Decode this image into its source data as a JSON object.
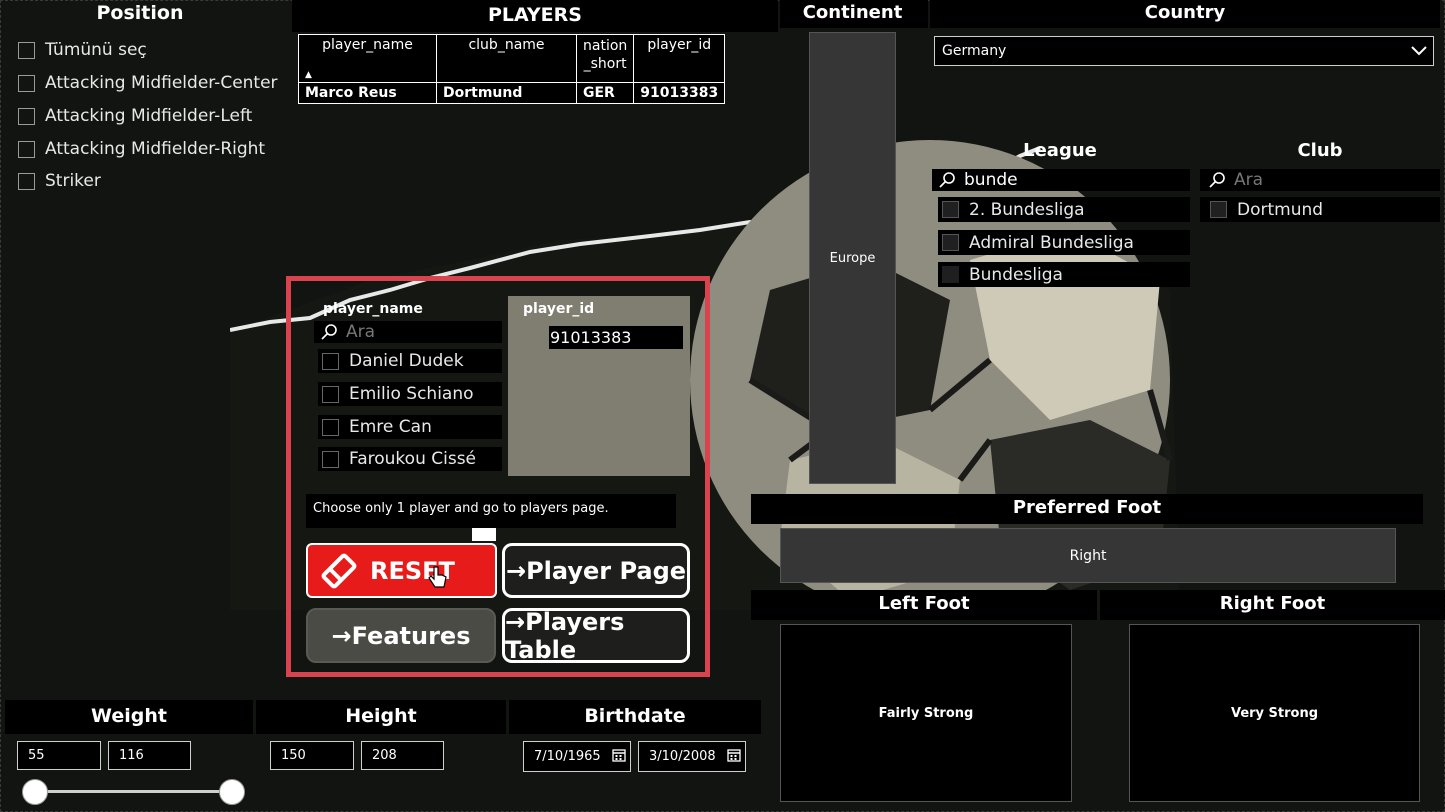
{
  "position": {
    "title": "Position",
    "items": [
      {
        "label": "Tümünü seç"
      },
      {
        "label": "Attacking Midfielder-Center"
      },
      {
        "label": "Attacking Midfielder-Left"
      },
      {
        "label": "Attacking Midfielder-Right"
      },
      {
        "label": "Striker"
      }
    ]
  },
  "players_table": {
    "title": "PLAYERS",
    "columns": [
      "player_name",
      "club_name",
      "nation\n_short",
      "player_id"
    ],
    "rows": [
      [
        "Marco Reus",
        "Dortmund",
        "GER",
        "91013383"
      ]
    ]
  },
  "continent": {
    "title": "Continent",
    "value": "Europe"
  },
  "country": {
    "title": "Country",
    "selected": "Germany"
  },
  "league": {
    "title": "League",
    "search_value": "bunde",
    "items": [
      {
        "label": "2. Bundesliga"
      },
      {
        "label": "Admiral Bundesliga"
      },
      {
        "label": "Bundesliga"
      }
    ]
  },
  "club": {
    "title": "Club",
    "search_placeholder": "Ara",
    "items": [
      {
        "label": "Dortmund"
      }
    ]
  },
  "player_panel": {
    "name_title": "player_name",
    "id_title": "player_id",
    "search_placeholder": "Ara",
    "players": [
      {
        "label": "Daniel Dudek"
      },
      {
        "label": "Emilio Schiano"
      },
      {
        "label": "Emre Can"
      },
      {
        "label": "Faroukou Cissé"
      }
    ],
    "player_id_value": "91013383",
    "tooltip": "Choose only 1 player and go to players page."
  },
  "buttons": {
    "reset": "RESET",
    "player_page": "→Player Page",
    "features": "→Features",
    "players_table": "→Players Table"
  },
  "preferred_foot": {
    "title": "Preferred Foot",
    "value": "Right"
  },
  "left_foot": {
    "title": "Left Foot",
    "value": "Fairly Strong"
  },
  "right_foot": {
    "title": "Right Foot",
    "value": "Very Strong"
  },
  "weight": {
    "title": "Weight",
    "min": "55",
    "max": "116"
  },
  "height": {
    "title": "Height",
    "min": "150",
    "max": "208"
  },
  "birthdate": {
    "title": "Birthdate",
    "start": "7/10/1965",
    "end": "3/10/2008"
  },
  "colors": {
    "accent_red": "#e02020",
    "panel_border": "#d9434e"
  }
}
